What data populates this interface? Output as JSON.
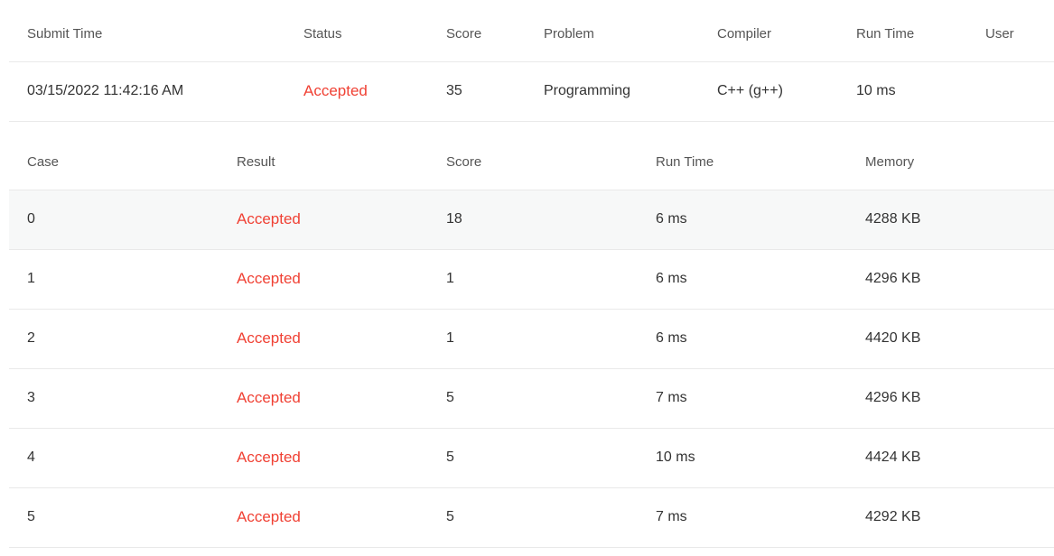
{
  "summary": {
    "headers": {
      "submit_time": "Submit Time",
      "status": "Status",
      "score": "Score",
      "problem": "Problem",
      "compiler": "Compiler",
      "run_time": "Run Time",
      "user": "User"
    },
    "row": {
      "submit_time": "03/15/2022 11:42:16 AM",
      "status": "Accepted",
      "score": "35",
      "problem": "Programming",
      "compiler": "C++ (g++)",
      "run_time": "10 ms",
      "user": ""
    }
  },
  "cases": {
    "headers": {
      "case": "Case",
      "result": "Result",
      "score": "Score",
      "run_time": "Run Time",
      "memory": "Memory"
    },
    "rows": [
      {
        "case": "0",
        "result": "Accepted",
        "score": "18",
        "run_time": "6 ms",
        "memory": "4288 KB"
      },
      {
        "case": "1",
        "result": "Accepted",
        "score": "1",
        "run_time": "6 ms",
        "memory": "4296 KB"
      },
      {
        "case": "2",
        "result": "Accepted",
        "score": "1",
        "run_time": "6 ms",
        "memory": "4420 KB"
      },
      {
        "case": "3",
        "result": "Accepted",
        "score": "5",
        "run_time": "7 ms",
        "memory": "4296 KB"
      },
      {
        "case": "4",
        "result": "Accepted",
        "score": "5",
        "run_time": "10 ms",
        "memory": "4424 KB"
      },
      {
        "case": "5",
        "result": "Accepted",
        "score": "5",
        "run_time": "7 ms",
        "memory": "4292 KB"
      }
    ]
  },
  "colors": {
    "accepted": "#f04134",
    "row_highlight": "#f7f8f8",
    "divider": "#e9e9e9"
  }
}
